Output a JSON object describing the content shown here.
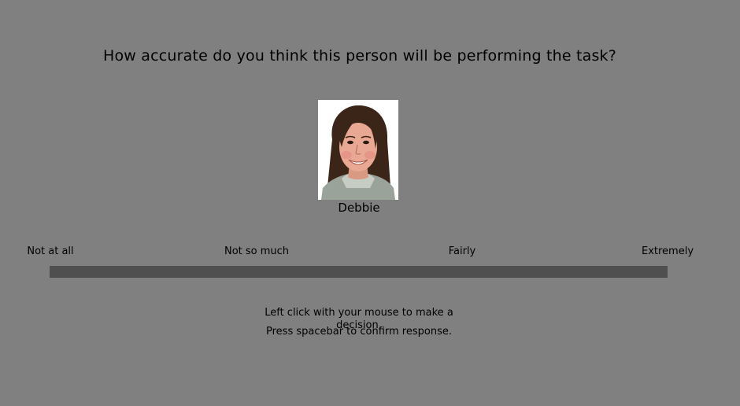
{
  "question": "How accurate do you think this person will be performing the task?",
  "person": {
    "name": "Debbie"
  },
  "scale": {
    "labels": [
      "Not at all",
      "Not so much",
      "Fairly",
      "Extremely"
    ],
    "track_color": "#4f4f4f"
  },
  "instructions": [
    "Left click with your mouse to make a decision.",
    "Press spacebar to confirm response."
  ],
  "colors": {
    "background": "#808080",
    "text": "#000000"
  }
}
